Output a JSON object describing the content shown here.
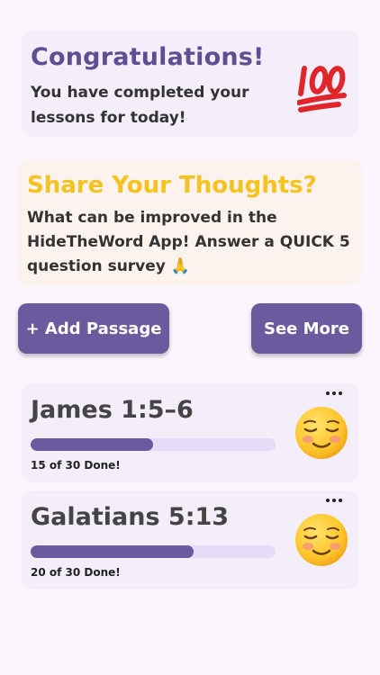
{
  "congrats": {
    "title": "Congratulations!",
    "message": "You have completed your lessons for today!",
    "icon": "hundred-points-icon"
  },
  "survey": {
    "title": "Share Your Thoughts?",
    "message": "What can be improved in the HideTheWord App! Answer a QUICK 5 question survey 🙏"
  },
  "actions": {
    "add_label": "+ Add Passage",
    "more_label": "See More"
  },
  "passages": [
    {
      "name": "James 1:5–6",
      "progress": 0.5,
      "status": "15 of 30 Done!",
      "icon": "smiling-face-icon"
    },
    {
      "name": "Galatians 5:13",
      "progress": 0.667,
      "status": "20 of 30 Done!",
      "icon": "smiling-face-icon"
    }
  ],
  "colors": {
    "accent": "#6a5a9e",
    "title_purple": "#5f4f92",
    "survey_title": "#f6c21f",
    "track": "#e5dcf7"
  }
}
